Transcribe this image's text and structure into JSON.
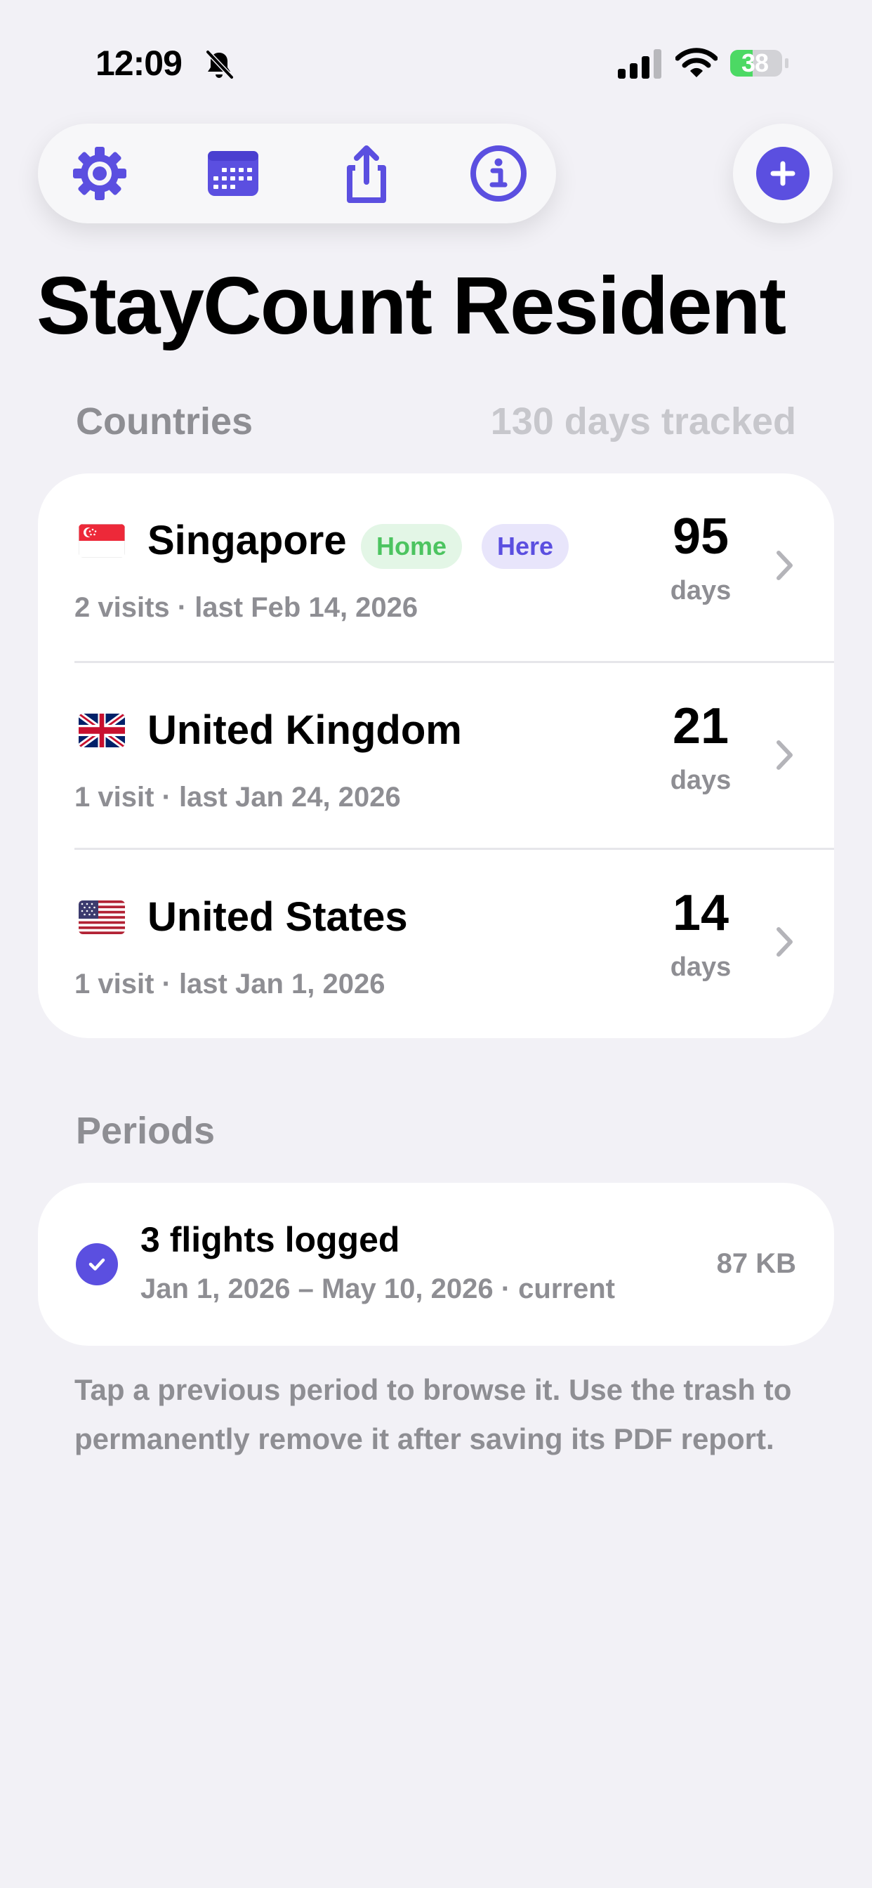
{
  "status_bar": {
    "time": "12:09",
    "battery": "38"
  },
  "toolbar": {
    "icons": [
      "gear-icon",
      "calendar-icon",
      "share-icon",
      "info-icon"
    ],
    "add_icon": "plus-icon"
  },
  "title": "StayCount Resident",
  "countries": {
    "label": "Countries",
    "tracked": "130 days tracked",
    "items": [
      {
        "name": "Singapore",
        "subtitle": "2 visits · last Feb 14, 2026",
        "days": "95",
        "days_label": "days",
        "badges": [
          "Home",
          "Here"
        ]
      },
      {
        "name": "United Kingdom",
        "subtitle": "1 visit · last Jan 24, 2026",
        "days": "21",
        "days_label": "days"
      },
      {
        "name": "United States",
        "subtitle": "1 visit · last Jan 1, 2026",
        "days": "14",
        "days_label": "days"
      }
    ]
  },
  "periods": {
    "label": "Periods",
    "items": [
      {
        "title": "3 flights logged",
        "subtitle": "Jan 1, 2026 – May 10, 2026 · current",
        "size": "87 KB",
        "selected": true
      }
    ]
  },
  "footnote": "Tap a previous period to browse it. Use the trash to permanently remove it after saving its PDF report.",
  "colors": {
    "accent": "#5b4fe0",
    "home_green": "#4cc460",
    "background": "#f2f1f6",
    "secondary_text": "#8e8e93"
  }
}
